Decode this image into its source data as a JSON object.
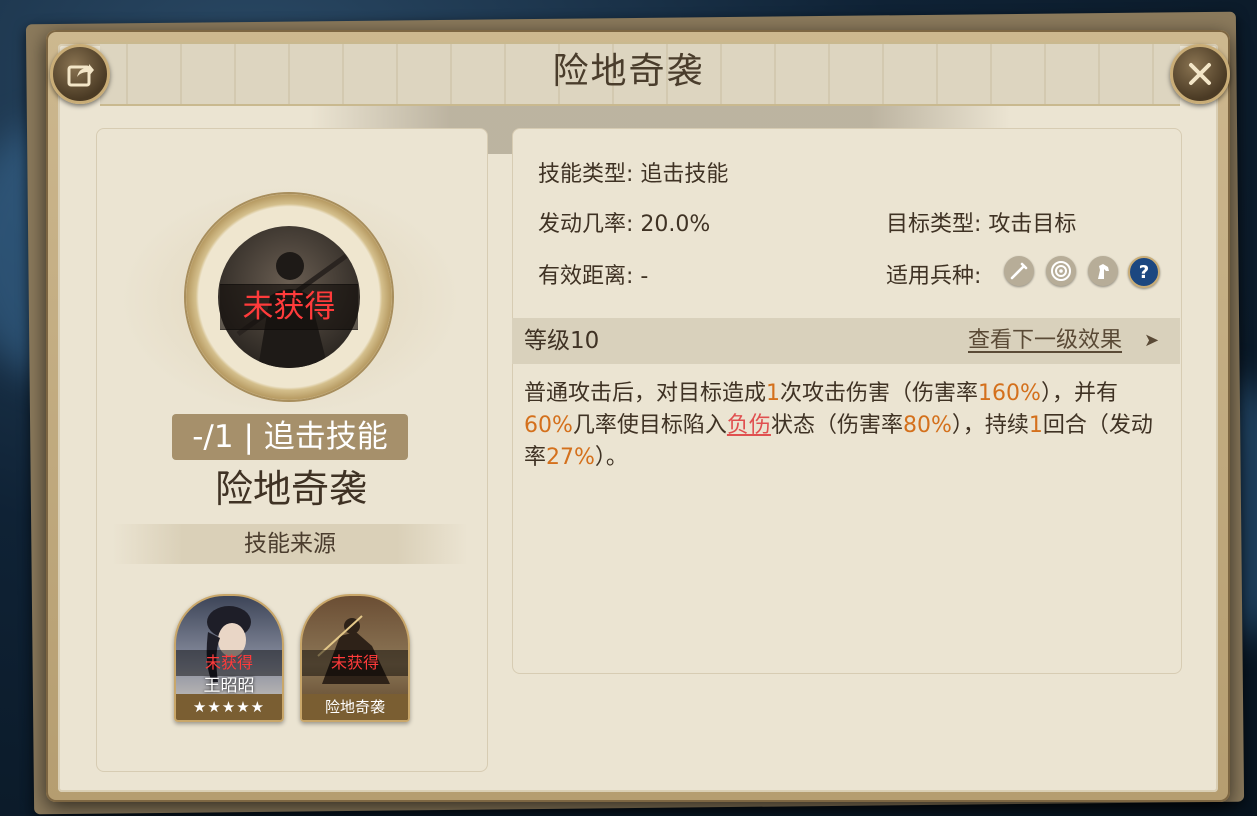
{
  "window": {
    "title": "险地奇袭"
  },
  "skill": {
    "portrait_status": "未获得",
    "count_type": "-/1 | 追击技能",
    "name": "险地奇袭",
    "source_label": "技能来源",
    "sources": [
      {
        "name": "王昭昭",
        "status": "未获得",
        "stars": "★★★★★"
      },
      {
        "name": "险地奇袭",
        "status": "未获得"
      }
    ]
  },
  "details": {
    "skill_type_label": "技能类型:",
    "skill_type_value": "追击技能",
    "trigger_rate_label": "发动几率:",
    "trigger_rate_value": "20.0%",
    "target_type_label": "目标类型:",
    "target_type_value": "攻击目标",
    "range_label": "有效距离:",
    "range_value": "-",
    "troop_label": "适用兵种:",
    "troop_icons": [
      "sword-icon",
      "target-icon",
      "horse-icon",
      "question-icon"
    ],
    "level_label": "等级10",
    "next_level_link": "查看下一级效果",
    "description": {
      "p1": "普通攻击后，对目标造成",
      "v1": "1",
      "p2": "次攻击伤害（伤害率",
      "v2": "160%",
      "p3": "），并有",
      "v3": "60%",
      "p4": "几率使目标陷入",
      "v4": "负伤",
      "p5": "状态（伤害率",
      "v5": "80%",
      "p6": "），持续",
      "v6": "1",
      "p7": "回合（发动率",
      "v7": "27%",
      "p8": "）。"
    }
  },
  "colors": {
    "highlight": "#d4701c",
    "status_red": "#ff3b3b"
  }
}
